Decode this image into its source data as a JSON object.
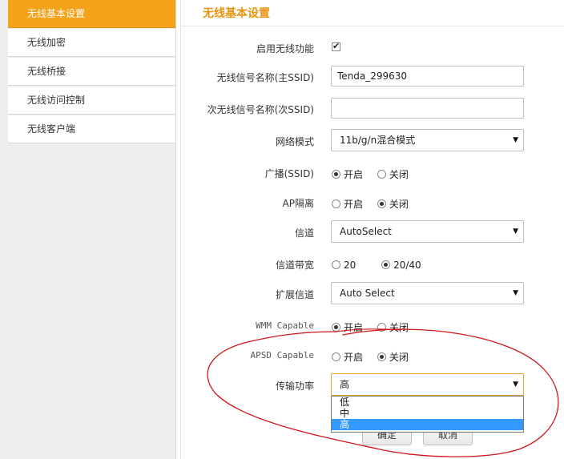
{
  "sidebar": {
    "items": [
      {
        "label": "无线基本设置",
        "active": true
      },
      {
        "label": "无线加密"
      },
      {
        "label": "无线桥接"
      },
      {
        "label": "无线访问控制"
      },
      {
        "label": "无线客户端"
      }
    ]
  },
  "page": {
    "title": "无线基本设置"
  },
  "form": {
    "enable_wireless": {
      "label": "启用无线功能",
      "checked": true
    },
    "ssid_primary": {
      "label": "无线信号名称(主SSID)",
      "value": "Tenda_299630"
    },
    "ssid_secondary": {
      "label": "次无线信号名称(次SSID)",
      "value": ""
    },
    "network_mode": {
      "label": "网络模式",
      "value": "11b/g/n混合模式"
    },
    "broadcast": {
      "label": "广播(SSID)",
      "options": [
        "开启",
        "关闭"
      ],
      "selected": "开启"
    },
    "ap_isolation": {
      "label": "AP隔离",
      "options": [
        "开启",
        "关闭"
      ],
      "selected": "关闭"
    },
    "channel": {
      "label": "信道",
      "value": "AutoSelect"
    },
    "bandwidth": {
      "label": "信道带宽",
      "options": [
        "20",
        "20/40"
      ],
      "selected": "20/40"
    },
    "ext_channel": {
      "label": "扩展信道",
      "value": "Auto Select"
    },
    "wmm": {
      "label": "WMM Capable",
      "options": [
        "开启",
        "关闭"
      ],
      "selected": "开启"
    },
    "apsd": {
      "label": "APSD Capable",
      "options": [
        "开启",
        "关闭"
      ],
      "selected": "关闭"
    },
    "tx_power": {
      "label": "传输功率",
      "value": "高",
      "options": [
        "低",
        "中",
        "高"
      ],
      "highlighted": "高"
    }
  },
  "buttons": {
    "ok": "确定",
    "cancel": "取消"
  },
  "colors": {
    "accent": "#f4a21a",
    "title": "#e8920e",
    "annotation": "#d0151b",
    "highlight": "#3399ff"
  },
  "icons": {
    "dropdown_arrow": "triangle-down-icon",
    "checkbox_tick": "check-icon"
  }
}
